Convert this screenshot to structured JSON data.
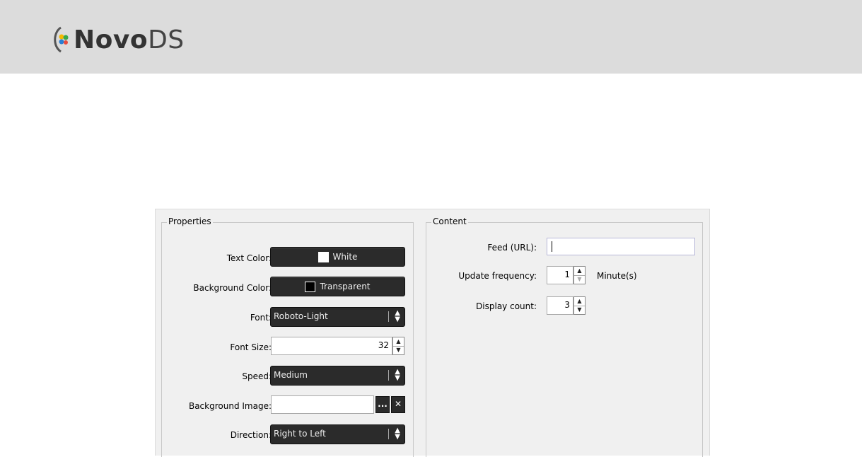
{
  "header": {
    "logo_bold": "Novo",
    "logo_light": "DS"
  },
  "properties": {
    "title": "Properties",
    "text_color_label": "Text Color:",
    "text_color_value": "White",
    "text_color_swatch": "#ffffff",
    "bg_color_label": "Background Color:",
    "bg_color_value": "Transparent",
    "bg_color_swatch": "#000000",
    "font_label": "Font:",
    "font_value": "Roboto-Light",
    "font_size_label": "Font Size:",
    "font_size_value": "32",
    "speed_label": "Speed:",
    "speed_value": "Medium",
    "bg_image_label": "Background Image:",
    "bg_image_value": "",
    "browse_label": "...",
    "clear_label": "✕",
    "direction_label": "Direction:",
    "direction_value": "Right to Left"
  },
  "content": {
    "title": "Content",
    "feed_label": "Feed (URL):",
    "feed_value": "",
    "update_label": "Update frequency:",
    "update_value": "1",
    "update_unit": "Minute(s)",
    "count_label": "Display count:",
    "count_value": "3"
  }
}
